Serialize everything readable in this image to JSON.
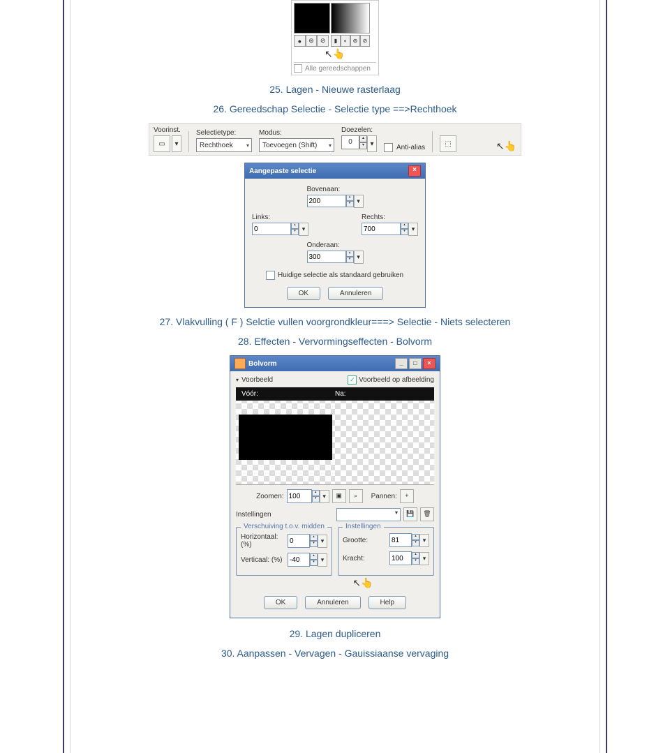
{
  "steps": {
    "s25": "25. Lagen - Nieuwe rasterlaag",
    "s26": "26. Gereedschap Selectie - Selectie type ==>Rechthoek",
    "s27": "27. Vlakvulling ( F ) Selctie vullen voorgrondkleur===> Selectie - Niets selecteren",
    "s28": "28. Effecten - Vervormingseffecten - Bolvorm",
    "s29": "29. Lagen dupliceren",
    "s30": "30. Aanpassen - Vervagen - Gauissiaanse vervaging"
  },
  "fig1": {
    "all_tools": "Alle gereedschappen"
  },
  "fig2": {
    "voorinst": "Voorinst.",
    "selectietype": "Selectietype:",
    "selectietype_value": "Rechthoek",
    "modus": "Modus:",
    "modus_value": "Toevoegen (Shift)",
    "doezelen": "Doezelen:",
    "doezelen_value": "0",
    "anti_alias": "Anti-alias"
  },
  "fig3": {
    "title": "Aangepaste selectie",
    "bovenaan": "Bovenaan:",
    "bovenaan_value": "200",
    "links": "Links:",
    "links_value": "0",
    "rechts": "Rechts:",
    "rechts_value": "700",
    "onderaan": "Onderaan:",
    "onderaan_value": "300",
    "std": "Huidige selectie als standaard gebruiken",
    "ok": "OK",
    "annuleren": "Annuleren"
  },
  "fig4": {
    "title": "Bolvorm",
    "voorbeeld": "Voorbeeld",
    "voorbeeld_op": "Voorbeeld op afbeelding",
    "voor": "Vóór:",
    "na": "Na:",
    "zoomen": "Zoomen:",
    "zoom_value": "100",
    "pannen": "Pannen:",
    "pannen_value": "+",
    "instellingen": "Instellingen",
    "group1": "Verschuiving t.o.v. midden",
    "horizontaal": "Horizontaal: (%)",
    "horizontaal_value": "0",
    "verticaal": "Verticaal: (%)",
    "verticaal_value": "-40",
    "group2": "Instellingen",
    "grootte": "Grootte:",
    "grootte_value": "81",
    "kracht": "Kracht:",
    "kracht_value": "100",
    "ok": "OK",
    "annuleren": "Annuleren",
    "help": "Help"
  }
}
